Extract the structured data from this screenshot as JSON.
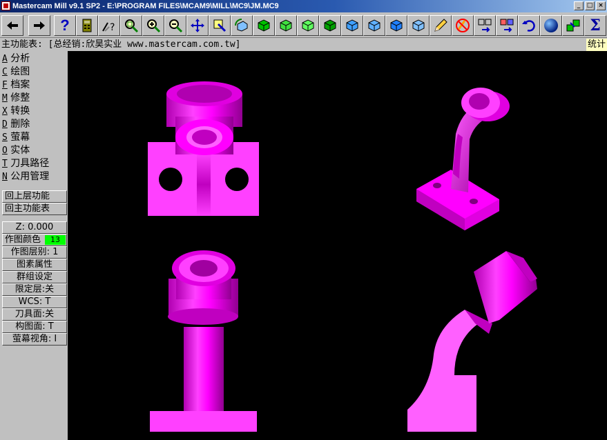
{
  "window": {
    "title": "Mastercam Mill v9.1 SP2 - E:\\PROGRAM FILES\\MCAM9\\MILL\\MC9\\JM.MC9",
    "minimize_glyph": "_",
    "restore_glyph": "□",
    "close_glyph": "×"
  },
  "toolbar": {
    "buttons": [
      {
        "name": "back-arrow-icon"
      },
      {
        "name": "forward-arrow-icon"
      },
      {
        "name": "help-icon"
      },
      {
        "name": "calculator-icon"
      },
      {
        "name": "analyze-icon"
      },
      {
        "name": "zoom-window-icon"
      },
      {
        "name": "zoom-in-icon"
      },
      {
        "name": "zoom-out-icon"
      },
      {
        "name": "pan-icon"
      },
      {
        "name": "select-icon"
      },
      {
        "name": "rotate-icon"
      },
      {
        "name": "top-view-icon"
      },
      {
        "name": "front-view-icon"
      },
      {
        "name": "side-view-icon"
      },
      {
        "name": "iso-view-icon"
      },
      {
        "name": "cube-view-icon"
      },
      {
        "name": "cube-view-2-icon"
      },
      {
        "name": "cube-view-3-icon"
      },
      {
        "name": "cube-view-4-icon"
      },
      {
        "name": "pencil-icon"
      },
      {
        "name": "no-blank-icon"
      },
      {
        "name": "move-to-icon"
      },
      {
        "name": "copy-to-icon"
      },
      {
        "name": "undo-icon"
      },
      {
        "name": "shade-sphere-icon"
      },
      {
        "name": "solids-icon"
      },
      {
        "name": "sigma-icon"
      }
    ],
    "help_glyph": "?",
    "sigma_glyph": "Σ"
  },
  "prompt": {
    "text": "主功能表: [总经销:欣昊实业 www.mastercam.com.tw]",
    "stats_label": "统计"
  },
  "menu": {
    "items": [
      {
        "key": "A",
        "label": "分析"
      },
      {
        "key": "C",
        "label": "绘图"
      },
      {
        "key": "F",
        "label": "档案"
      },
      {
        "key": "M",
        "label": "修整"
      },
      {
        "key": "X",
        "label": "转换"
      },
      {
        "key": "D",
        "label": "删除"
      },
      {
        "key": "S",
        "label": "萤幕"
      },
      {
        "key": "O",
        "label": "实体"
      },
      {
        "key": "T",
        "label": "刀具路径"
      },
      {
        "key": "N",
        "label": "公用管理"
      }
    ],
    "back_up": "回上层功能",
    "main_menu": "回主功能表"
  },
  "settings": {
    "z_depth": "Z:  0.000",
    "color_label": "作图颜色",
    "color_value": "13",
    "level": "作图层别: 1",
    "attributes": "图素属性",
    "groups": "群组设定",
    "mask": "限定层:关",
    "wcs": "WCS:  T",
    "tool_plane": "刀具面:关",
    "construction_plane": "构图面: T",
    "graphics_view": "萤幕视角: I"
  },
  "colors": {
    "part_magenta": "#ff00ff",
    "viewport_bg": "#000000",
    "color_swatch": "#00ff00"
  }
}
